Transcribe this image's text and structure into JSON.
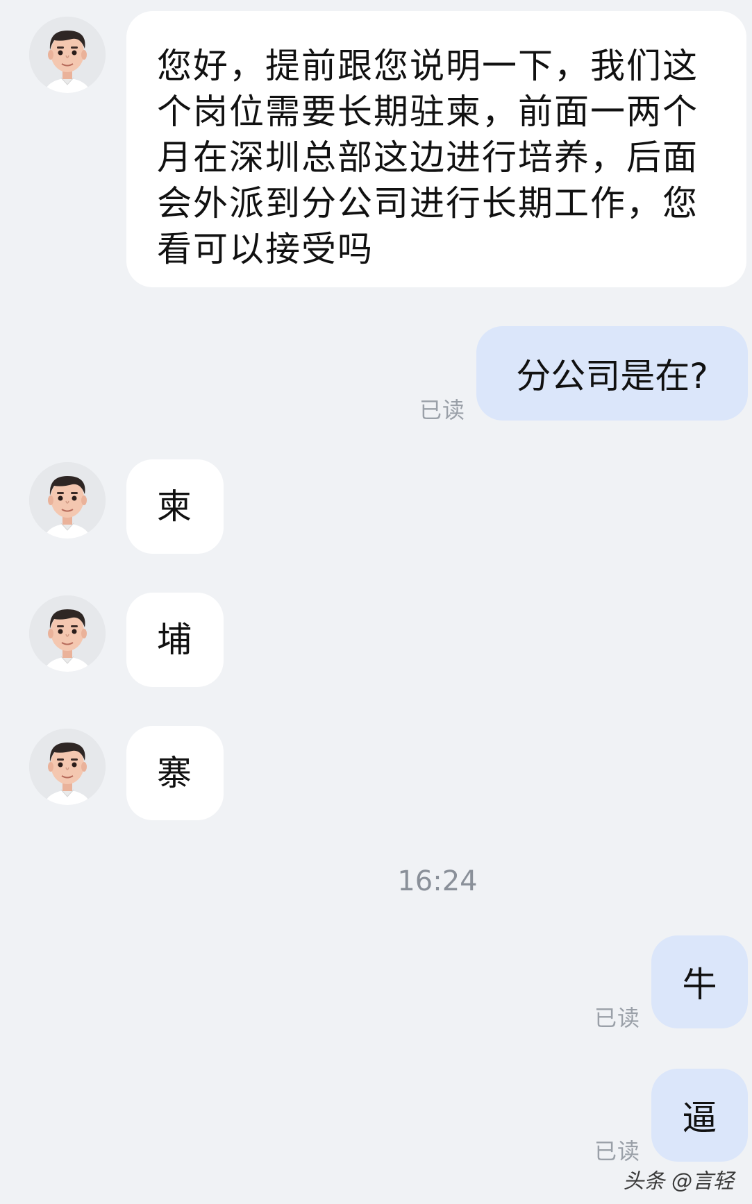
{
  "messages": [
    {
      "side": "in",
      "text": "您好，提前跟您说明一下，我们这个岗位需要长期驻柬，前面一两个月在深圳总部这边进行培养，后面会外派到分公司进行长期工作，您看可以接受吗"
    },
    {
      "side": "out",
      "text": "分公司是在?",
      "status": "已读"
    },
    {
      "side": "in",
      "text": "柬"
    },
    {
      "side": "in",
      "text": "埔"
    },
    {
      "side": "in",
      "text": "寨"
    },
    {
      "side": "out",
      "text": "牛",
      "status": "已读"
    },
    {
      "side": "out",
      "text": "逼",
      "status": "已读"
    }
  ],
  "timestamp": "16:24",
  "watermark": "头条 @言轻",
  "colors": {
    "background": "#f0f2f5",
    "incoming_bubble": "#ffffff",
    "outgoing_bubble": "#dbe6fa"
  }
}
